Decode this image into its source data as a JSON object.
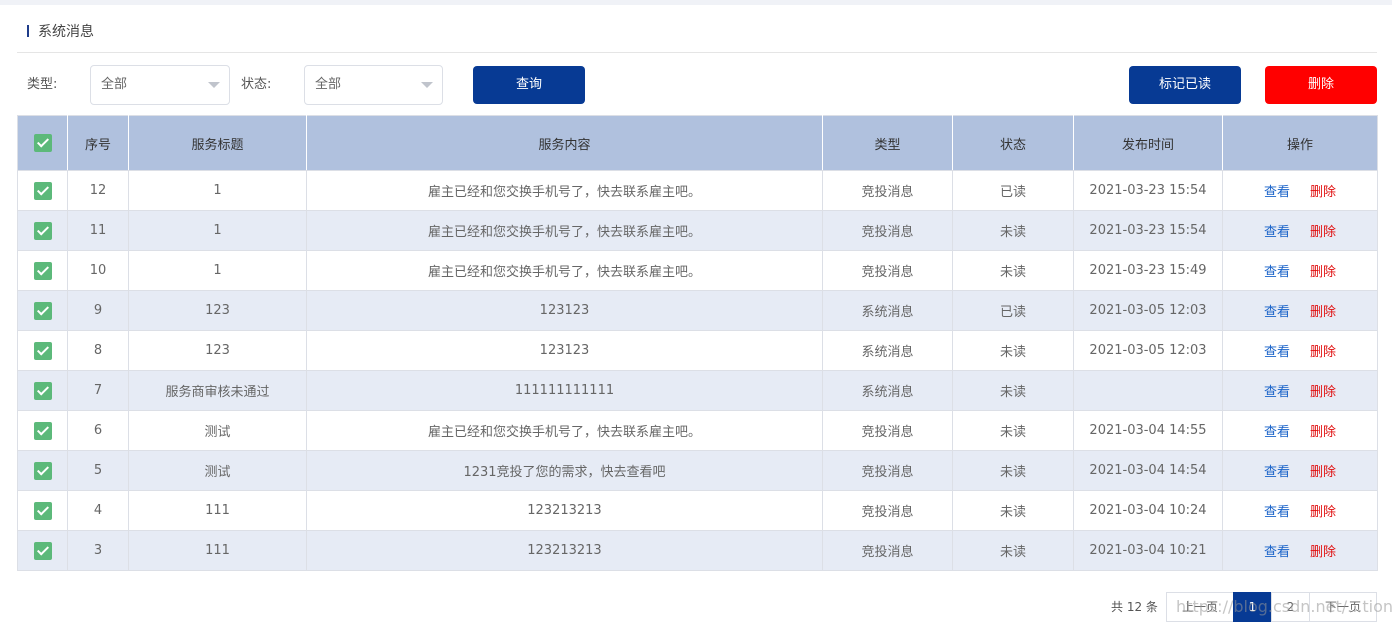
{
  "header": {
    "title": "系统消息"
  },
  "filters": {
    "type_label": "类型:",
    "type_value": "全部",
    "status_label": "状态:",
    "status_value": "全部",
    "query_label": "查询",
    "mark_read_label": "标记已读",
    "delete_label": "删除"
  },
  "table": {
    "columns": [
      "序号",
      "服务标题",
      "服务内容",
      "类型",
      "状态",
      "发布时间",
      "操作"
    ],
    "rows": [
      {
        "no": "12",
        "title": "1",
        "content": "雇主已经和您交换手机号了，快去联系雇主吧。",
        "type": "竞投消息",
        "status": "已读",
        "time": "2021-03-23 15:54",
        "view": "查看",
        "del": "删除"
      },
      {
        "no": "11",
        "title": "1",
        "content": "雇主已经和您交换手机号了，快去联系雇主吧。",
        "type": "竞投消息",
        "status": "未读",
        "time": "2021-03-23 15:54",
        "view": "查看",
        "del": "删除"
      },
      {
        "no": "10",
        "title": "1",
        "content": "雇主已经和您交换手机号了，快去联系雇主吧。",
        "type": "竞投消息",
        "status": "未读",
        "time": "2021-03-23 15:49",
        "view": "查看",
        "del": "删除"
      },
      {
        "no": "9",
        "title": "123",
        "content": "123123",
        "type": "系统消息",
        "status": "已读",
        "time": "2021-03-05 12:03",
        "view": "查看",
        "del": "删除"
      },
      {
        "no": "8",
        "title": "123",
        "content": "123123",
        "type": "系统消息",
        "status": "未读",
        "time": "2021-03-05 12:03",
        "view": "查看",
        "del": "删除"
      },
      {
        "no": "7",
        "title": "服务商审核未通过",
        "content": "111111111111",
        "type": "系统消息",
        "status": "未读",
        "time": "",
        "view": "查看",
        "del": "删除"
      },
      {
        "no": "6",
        "title": "测试",
        "content": "雇主已经和您交换手机号了，快去联系雇主吧。",
        "type": "竞投消息",
        "status": "未读",
        "time": "2021-03-04 14:55",
        "view": "查看",
        "del": "删除"
      },
      {
        "no": "5",
        "title": "测试",
        "content": "1231竞投了您的需求，快去查看吧",
        "type": "竞投消息",
        "status": "未读",
        "time": "2021-03-04 14:54",
        "view": "查看",
        "del": "删除"
      },
      {
        "no": "4",
        "title": "111",
        "content": "123213213",
        "type": "竞投消息",
        "status": "未读",
        "time": "2021-03-04 10:24",
        "view": "查看",
        "del": "删除"
      },
      {
        "no": "3",
        "title": "111",
        "content": "123213213",
        "type": "竞投消息",
        "status": "未读",
        "time": "2021-03-04 10:21",
        "view": "查看",
        "del": "删除"
      }
    ]
  },
  "pagination": {
    "total": "共 12 条",
    "prev": "上一页",
    "pages": [
      "1",
      "2"
    ],
    "current": "1",
    "next": "下一页"
  },
  "watermark": "https://blog.csdn.net/...tion",
  "colors": {
    "primary": "#073a94",
    "danger": "#ff0000",
    "header_bg": "#b0c1de",
    "alt_row": "#e6ebf5",
    "checkbox": "#5cb97a"
  }
}
